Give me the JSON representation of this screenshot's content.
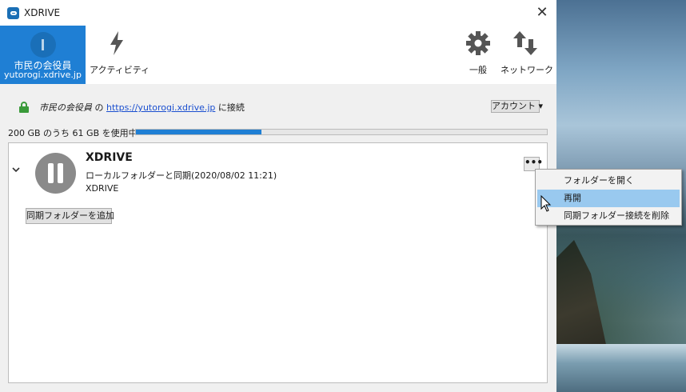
{
  "window": {
    "title": "XDRIVE"
  },
  "account": {
    "name": "市民の会役員",
    "host": "yutorogi.xdrive.jp"
  },
  "toolbar": {
    "activity_label": "アクティビティ",
    "general_label": "一般",
    "network_label": "ネットワーク"
  },
  "status": {
    "account_name": "市民の会役員",
    "connector": "の",
    "url": "https://yutorogi.xdrive.jp",
    "suffix": "に接続",
    "account_button": "アカウント ▾"
  },
  "storage": {
    "text": "200 GB のうち 61 GB を使用中",
    "used_gb": 61,
    "total_gb": 200
  },
  "sync": {
    "title": "XDRIVE",
    "status": "ローカルフォルダーと同期(2020/08/02 11:21)",
    "path": "XDRIVE",
    "more": "•••",
    "add_folder": "同期フォルダーを追加"
  },
  "menu": {
    "items": [
      {
        "label": "フォルダーを開く",
        "hover": false
      },
      {
        "label": "再開",
        "hover": true
      },
      {
        "label": "同期フォルダー接続を削除",
        "hover": false
      }
    ]
  },
  "colors": {
    "accent": "#1f7fd4",
    "menu_hover": "#99c9ef",
    "link": "#1a4fd0"
  }
}
